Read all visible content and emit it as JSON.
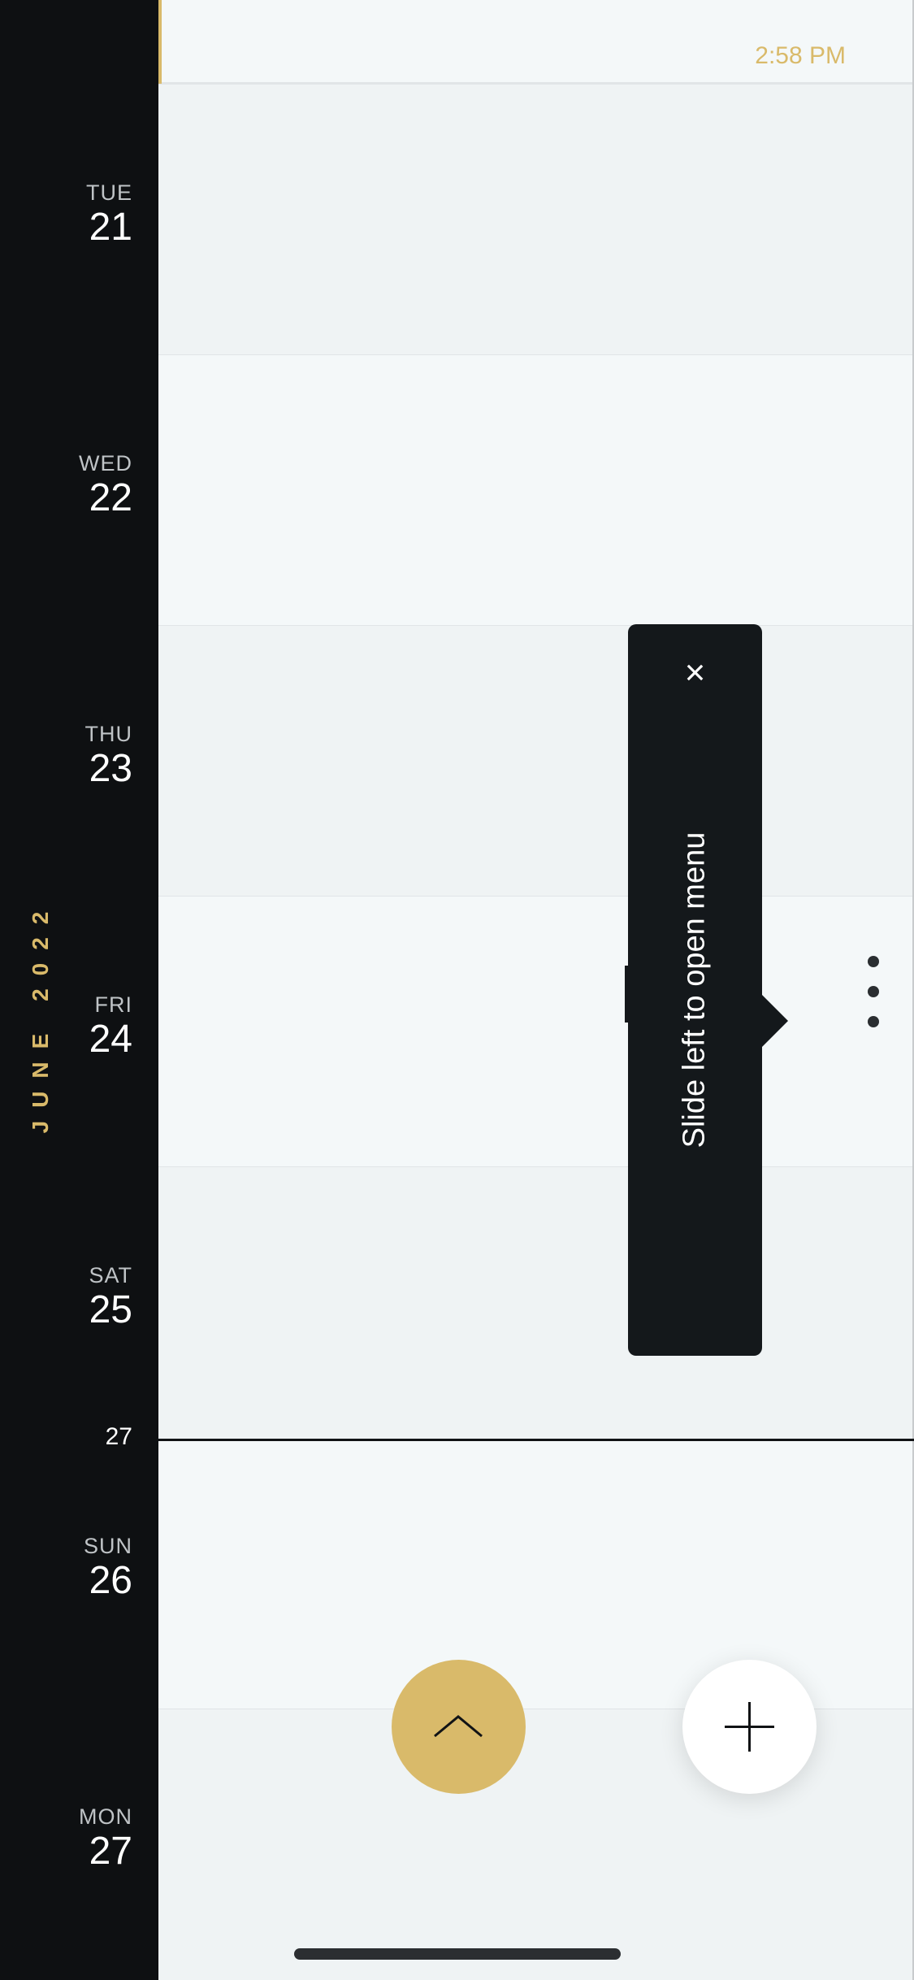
{
  "calendar": {
    "month_label": "JUNE 2022",
    "current_time": "2:58 PM",
    "week_number": "27",
    "days": [
      {
        "dow": "TUE",
        "num": "21"
      },
      {
        "dow": "WED",
        "num": "22"
      },
      {
        "dow": "THU",
        "num": "23"
      },
      {
        "dow": "FRI",
        "num": "24"
      },
      {
        "dow": "SAT",
        "num": "25"
      },
      {
        "dow": "SUN",
        "num": "26"
      },
      {
        "dow": "MON",
        "num": "27"
      }
    ]
  },
  "tooltip": {
    "close_glyph": "×",
    "text": "Slide left to open menu"
  },
  "icons": {
    "close": "close-icon",
    "more": "more-vertical-icon",
    "scroll_up": "chevron-up-icon",
    "add": "plus-icon"
  },
  "colors": {
    "accent": "#d9ba6a",
    "sidebar": "#0e1012",
    "tooltip": "#14181b"
  }
}
